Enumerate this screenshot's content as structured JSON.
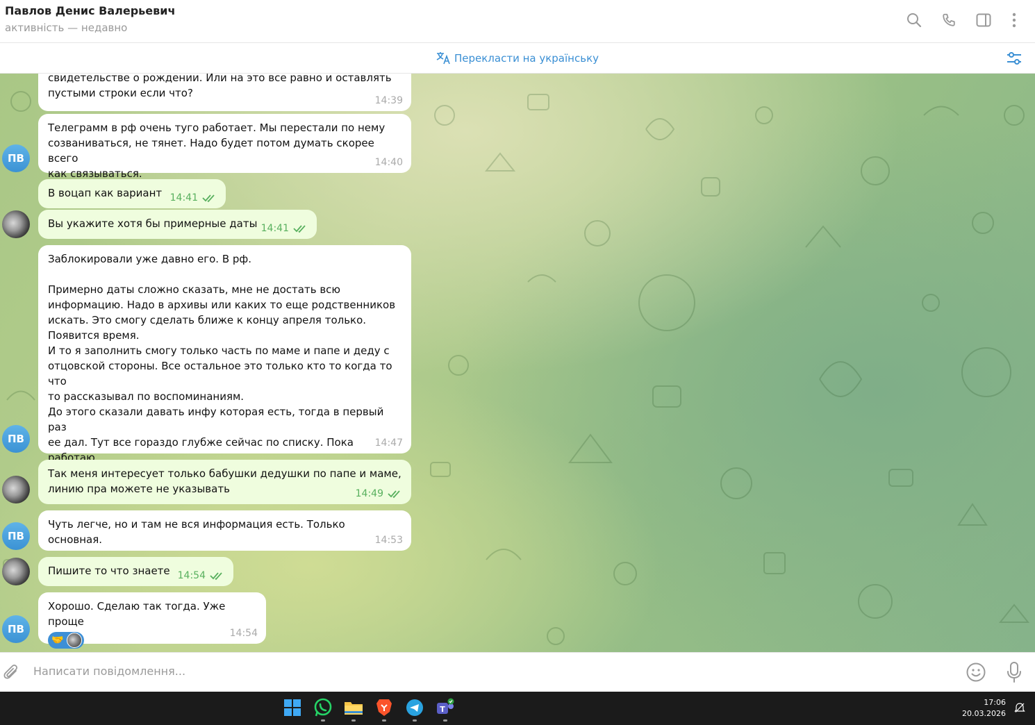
{
  "header": {
    "contact_name": "Павлов Денис Валерьевич",
    "status": "активність — недавно"
  },
  "translate_bar": {
    "label": "Перекласти на українську"
  },
  "messages": [
    {
      "dir": "in",
      "text": "свидетельстве о рождении. Или на это все равно и оставлять\nпустыми строки если что?",
      "time": "14:39"
    },
    {
      "dir": "in",
      "text": "Телеграмм в рф очень туго работает. Мы перестали по нему\nсозваниваться, не тянет. Надо будет потом думать скорее всего\nкак связываться.",
      "time": "14:40",
      "avatar": "ПВ"
    },
    {
      "dir": "out",
      "text": "В воцап как вариант",
      "time": "14:41"
    },
    {
      "dir": "out",
      "text": "Вы укажите хотя бы примерные даты",
      "time": "14:41"
    },
    {
      "dir": "in",
      "text": "Заблокировали уже давно его. В рф.\n\nПримерно даты сложно сказать, мне не достать всю\nинформацию. Надо в архивы или каких то еще родственников\nискать. Это смогу сделать ближе к концу апреля только.\nПоявится время.\nИ то я заполнить смогу только часть по маме и папе и деду с\nотцовской стороны. Все остальное это только кто то когда то что\nто рассказывал по воспоминаниям.\nДо этого сказали давать инфу которая есть, тогда в первый раз\nее дал. Тут все гораздо глубже сейчас по списку. Пока работаю\nнад этим. Но гарантий не могу дать что новое смогу раскопать.",
      "time": "14:47",
      "avatar": "ПВ"
    },
    {
      "dir": "out",
      "text": "Так меня интересует только бабушки дедушки по папе и маме,\nлинию пра можете не указывать",
      "time": "14:49"
    },
    {
      "dir": "in",
      "text": "Чуть легче, но и там не вся информация есть. Только основная.",
      "time": "14:53",
      "avatar": "ПВ"
    },
    {
      "dir": "out",
      "text": "Пишите то что знаете",
      "time": "14:54"
    },
    {
      "dir": "in",
      "text": "Хорошо. Сделаю так тогда. Уже проще",
      "time": "14:54",
      "avatar": "ПВ",
      "reaction": "🤝"
    }
  ],
  "input": {
    "placeholder": "Написати повідомлення..."
  },
  "taskbar": {
    "time": "17:06",
    "date": "20.03.2026"
  },
  "colors": {
    "accent": "#3a8fd4",
    "outgoing_bubble": "#effdde",
    "check_green": "#58b05e",
    "avatar_blue": "#3b92d4"
  }
}
